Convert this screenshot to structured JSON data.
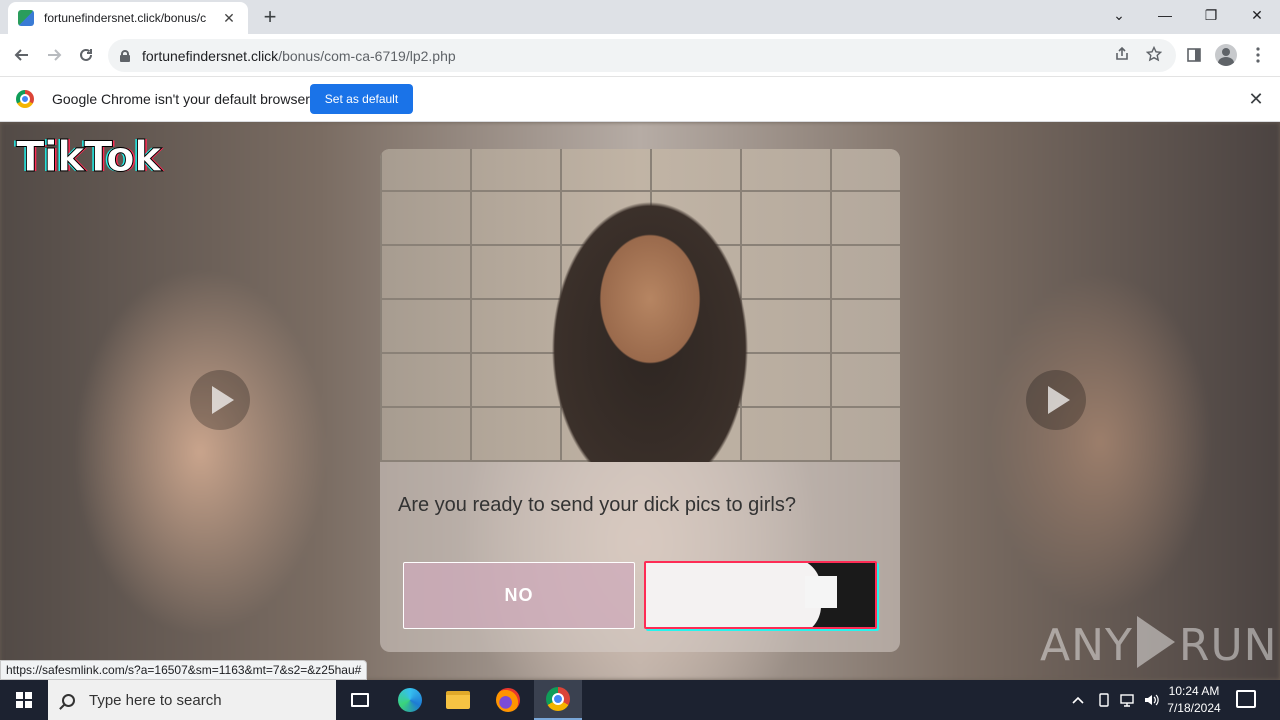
{
  "browser": {
    "tab_title": "fortunefindersnet.click/bonus/c",
    "tab_close": "✕",
    "new_tab": "+",
    "url_host": "fortunefindersnet.click",
    "url_path": "/bonus/com-ca-6719/lp2.php",
    "window_controls": {
      "minimize": "—",
      "restore": "❐",
      "close": "✕",
      "tab_search": "⌄"
    }
  },
  "infobar": {
    "message": "Google Chrome isn't your default browser",
    "button": "Set as default",
    "close": "✕"
  },
  "page": {
    "logo_text": "TikTok",
    "question": "Are you ready to send your dick pics to girls?",
    "no_label": "NO",
    "status_url": "https://safesmlink.com/s?a=16507&sm=1163&mt=7&s2=&z25hau#",
    "watermark_left": "ANY",
    "watermark_right": "RUN"
  },
  "taskbar": {
    "search_placeholder": "Type here to search",
    "time": "10:24 AM",
    "date": "7/18/2024"
  },
  "icons": {
    "back": "arrow-left-icon",
    "forward": "arrow-right-icon",
    "reload": "reload-icon",
    "share": "share-icon",
    "star": "star-icon",
    "sidepanel": "side-panel-icon",
    "profile": "profile-icon",
    "menu": "kebab-menu-icon"
  }
}
